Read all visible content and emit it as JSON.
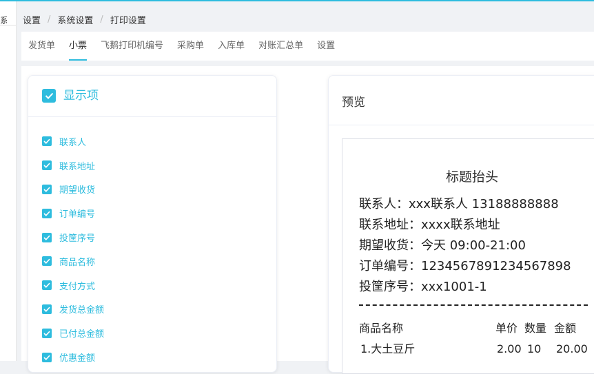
{
  "sidebar": {
    "fragment": "系"
  },
  "breadcrumb": {
    "items": [
      "设置",
      "系统设置",
      "打印设置"
    ]
  },
  "tabs": [
    {
      "label": "发货单",
      "active": false
    },
    {
      "label": "小票",
      "active": true
    },
    {
      "label": "飞鹅打印机编号",
      "active": false
    },
    {
      "label": "采购单",
      "active": false
    },
    {
      "label": "入库单",
      "active": false
    },
    {
      "label": "对账汇总单",
      "active": false
    },
    {
      "label": "设置",
      "active": false
    }
  ],
  "options_panel": {
    "title": "显示项",
    "items": [
      {
        "label": "联系人",
        "checked": true
      },
      {
        "label": "联系地址",
        "checked": true
      },
      {
        "label": "期望收货",
        "checked": true
      },
      {
        "label": "订单编号",
        "checked": true
      },
      {
        "label": "投筐序号",
        "checked": true
      },
      {
        "label": "商品名称",
        "checked": true
      },
      {
        "label": "支付方式",
        "checked": true
      },
      {
        "label": "发货总金额",
        "checked": true
      },
      {
        "label": "已付总金额",
        "checked": true
      },
      {
        "label": "优惠金额",
        "checked": true
      }
    ]
  },
  "preview": {
    "title": "预览",
    "receipt": {
      "header": "标题抬头",
      "lines": [
        "联系人：xxx联系人 13188888888",
        "联系地址：xxxx联系地址",
        "期望收货：今天 09:00-21:00",
        "订单编号：1234567891234567898",
        "投筐序号：xxx1001-1"
      ],
      "table": {
        "headers": [
          "商品名称",
          "单价",
          "数量",
          "金额"
        ],
        "rows": [
          [
            "1.大土豆斤",
            "2.00",
            "10",
            "20.00"
          ]
        ]
      }
    }
  },
  "colors": {
    "accent": "#2ebcde"
  }
}
